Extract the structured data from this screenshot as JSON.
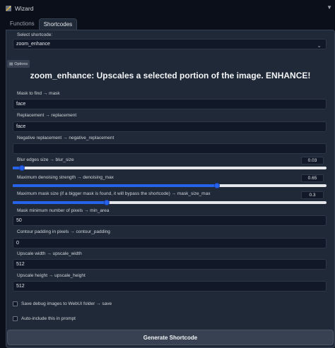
{
  "header": {
    "title": "Wizard",
    "icon": "wand-icon",
    "collapse_icon": "triangle-down-icon"
  },
  "tabs": [
    {
      "label": "Functions",
      "active": false
    },
    {
      "label": "Shortcodes",
      "active": true
    }
  ],
  "select_shortcode": {
    "label": "Select shortcode:",
    "value": "zoom_enhance"
  },
  "options_button": {
    "label": "Options"
  },
  "heading": "zoom_enhance: Upscales a selected portion of the image. ENHANCE!",
  "fields": {
    "mask": {
      "label": "Mask to find → mask",
      "value": "face"
    },
    "replacement": {
      "label": "Replacement → replacement",
      "value": "face"
    },
    "negative_replacement": {
      "label": "Negative replacement → negative_replacement",
      "value": ""
    },
    "min_area": {
      "label": "Mask minimum number of pixels → min_area",
      "value": "50"
    },
    "contour_padding": {
      "label": "Contour padding in pixels → contour_padding",
      "value": "0"
    },
    "upscale_width": {
      "label": "Upscale width → upscale_width",
      "value": "512"
    },
    "upscale_height": {
      "label": "Upscale height → upscale_height",
      "value": "512"
    }
  },
  "sliders": {
    "blur_size": {
      "label": "Blur edges size → blur_size",
      "value": "0.03",
      "fraction": 0.03
    },
    "denoising_max": {
      "label": "Maximum denoising strength → denoising_max",
      "value": "0.65",
      "fraction": 0.65
    },
    "mask_size_max": {
      "label": "Maximum mask size (if a bigger mask is found, it will bypass the shortcode) → mask_size_max",
      "value": "0.3",
      "fraction": 0.3
    }
  },
  "checkboxes": {
    "save_debug": {
      "label": "Save debug images to WebUI folder → save",
      "checked": false
    },
    "auto_include": {
      "label": "Auto-include this in prompt",
      "checked": false
    }
  },
  "generate_button": {
    "label": "Generate Shortcode"
  },
  "colors": {
    "background": "#0b0f19",
    "panel": "#1f2937",
    "input": "#111827",
    "accent": "#2563eb"
  }
}
